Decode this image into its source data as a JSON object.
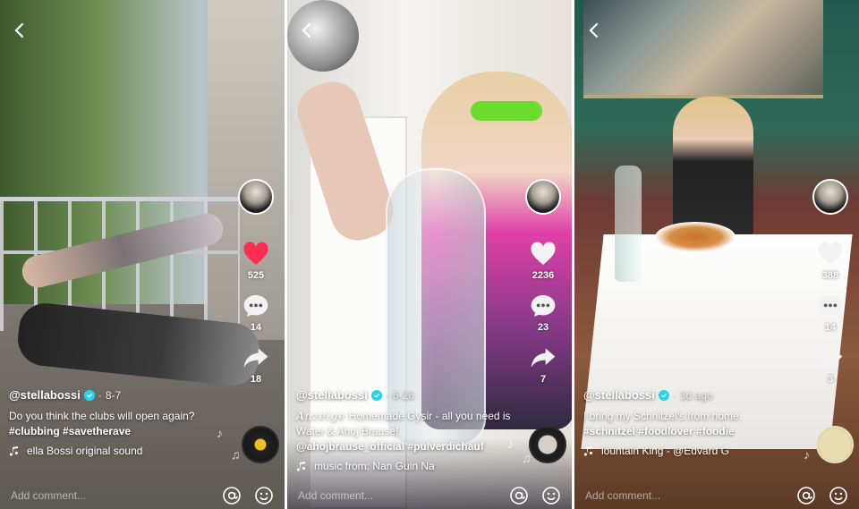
{
  "posts": [
    {
      "username": "@stellabossi",
      "date": "8-7",
      "description": "Do you think the clubs will open again?",
      "hashtags": "#clubbing #savetherave",
      "sound": "ella Bossi   original sound",
      "likes": "525",
      "comments": "14",
      "shares": "18",
      "liked": true,
      "comment_placeholder": "Add comment..."
    },
    {
      "username": "@stellabossi",
      "date": "6-26",
      "description_prefix": "Anzeige",
      "description": "Homemade Gysir - all you need is Water & Ahoj Brause!",
      "hashtags": "@ahojbrause_official #pulverdichauf",
      "sound": "music from: Nan Guin Na",
      "likes": "2236",
      "comments": "23",
      "shares": "7",
      "liked": false,
      "comment_placeholder": "Add comment..."
    },
    {
      "username": "@stellabossi",
      "date": "3d ago",
      "description": "I bring my Schnitzel's from home.",
      "hashtags": "#schnitzel #foodlover #foodie",
      "sound": "lountain King - @Edvard G",
      "likes": "388",
      "comments": "14",
      "shares": "3",
      "liked": false,
      "comment_placeholder": "Add comment..."
    }
  ],
  "colors": {
    "like_active": "#fe2c55",
    "verified": "#20d5ec"
  }
}
